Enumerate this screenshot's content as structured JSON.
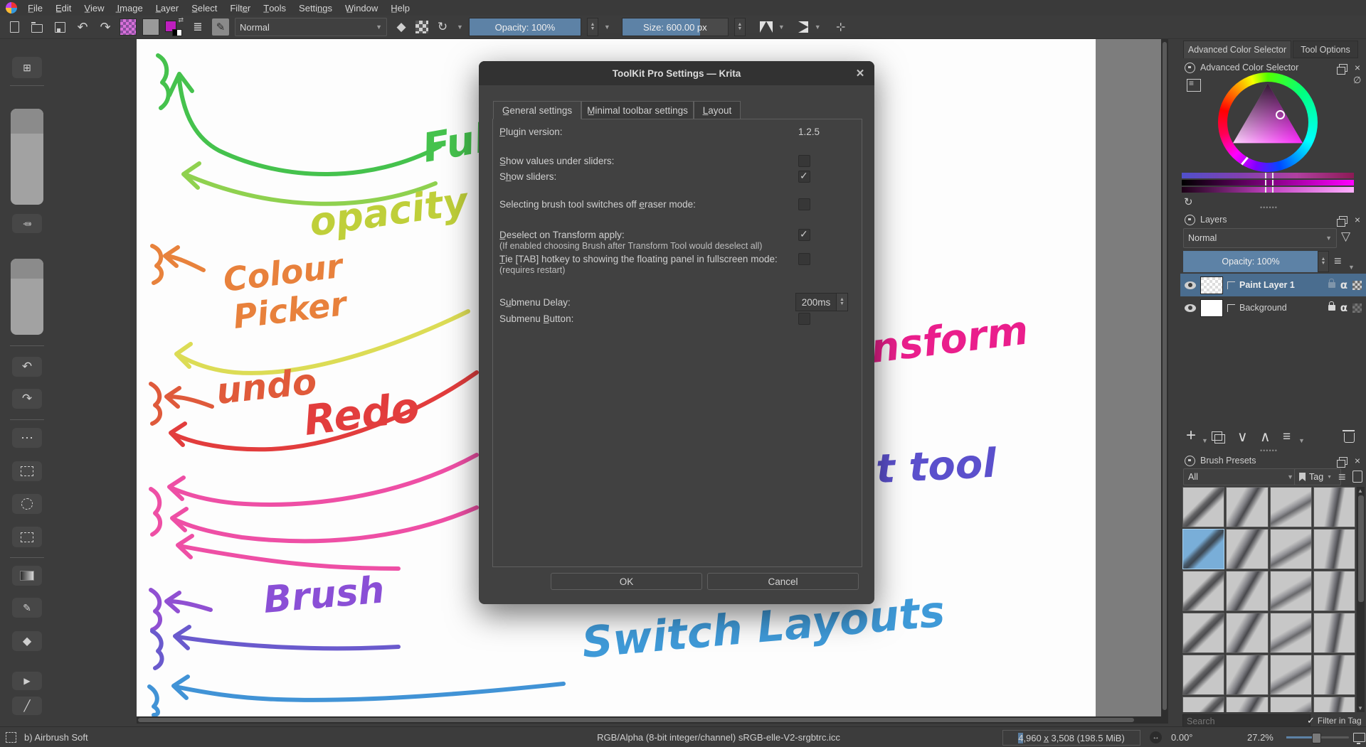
{
  "menu_bar": {
    "items": [
      {
        "label": "F̲ile"
      },
      {
        "label": "E̲dit"
      },
      {
        "label": "V̲iew"
      },
      {
        "label": "I̲mage"
      },
      {
        "label": "L̲ayer"
      },
      {
        "label": "S̲elect"
      },
      {
        "label": "Filte̲r"
      },
      {
        "label": "T̲ools"
      },
      {
        "label": "Settin̲gs"
      },
      {
        "label": "W̲indow"
      },
      {
        "label": "H̲elp"
      }
    ]
  },
  "toolbar": {
    "blend_mode": "Normal",
    "opacity_label": "Opacity: 100%",
    "size_label": "Size: 600.00 px"
  },
  "dialog": {
    "title": "ToolKit Pro Settings — Krita",
    "close_glyph": "✕",
    "tabs": [
      {
        "label": "G̲eneral settings"
      },
      {
        "label": "M̲inimal toolbar settings"
      },
      {
        "label": "L̲ayout"
      }
    ],
    "rows": [
      {
        "label": "P̲lugin version:",
        "value": "1.2.5"
      },
      {
        "label": "S̲how values under sliders:",
        "checked": false
      },
      {
        "label": "Sh̲ow sliders:",
        "checked": true
      },
      {
        "label": "Selecting brush tool switches off e̲raser mode:",
        "checked": false
      },
      {
        "label": "D̲eselect on Transform apply:",
        "sublabel": "(If enabled choosing Brush after Transform Tool would deselect all)",
        "checked": true
      },
      {
        "label": "T̲ie [TAB] hotkey to showing the floating panel in fullscreen mode:",
        "sublabel": "(requires restart)",
        "checked": false
      },
      {
        "label": "Su̲bmenu Delay:",
        "value": "200ms"
      },
      {
        "label": "Submenu B̲utton:",
        "checked": false
      }
    ],
    "ok_label": "OK",
    "cancel_label": "Cancel"
  },
  "right_panel": {
    "tabs": [
      {
        "label": "Advanced Color Selector"
      },
      {
        "label": "Tool Options"
      }
    ],
    "color_selector": {
      "title": "Advanced Color Selector"
    },
    "layers": {
      "title": "Layers",
      "blend_mode": "Normal",
      "opacity_label": "Opacity:  100%",
      "rows": [
        {
          "name": "Paint Layer 1",
          "selected": true
        },
        {
          "name": "Background",
          "selected": false
        }
      ]
    },
    "brush_presets": {
      "title": "Brush Presets",
      "filter_value": "All",
      "tag_label": "Tag",
      "search_placeholder": "Search",
      "filter_in_tag_label": "Filter in Tag",
      "filter_in_tag_checked": true,
      "grid": {
        "cols": 4,
        "rows": 6,
        "selected": 4
      }
    }
  },
  "status_bar": {
    "brush_name": "b) Airbrush Soft",
    "color_info": "RGB/Alpha (8-bit integer/channel)  sRGB-elle-V2-srgbtrc.icc",
    "dims_selected": "4",
    "dims_rest": ",960 x̲ 3,508 (198.5 MiB)",
    "angle": "0.00°",
    "zoom": "27.2%"
  },
  "annotations": {
    "full": "Full",
    "opacity": "opacity",
    "colour": "Colour",
    "picker": "Picker",
    "undo": "undo",
    "redo": "Redo",
    "brush": "Brush",
    "switch_layouts": "Switch Layouts",
    "transform": "Transform",
    "gradient_tool": "gradient tool"
  },
  "colors": {
    "accent_blue": "#5d82a6",
    "selected_row": "#4a6d8f",
    "panel_bg": "#3c3c3c",
    "dialog_bg": "#414141"
  }
}
